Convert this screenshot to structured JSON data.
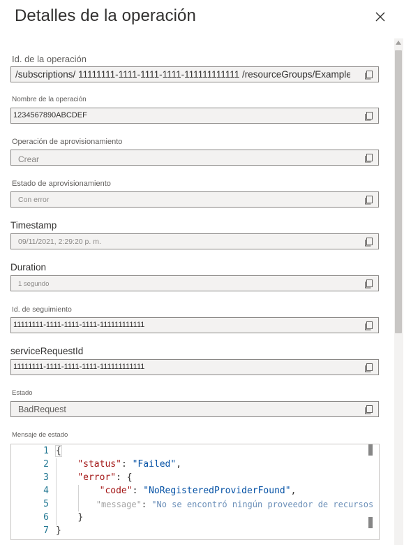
{
  "panel": {
    "title": "Detalles de la operación"
  },
  "fields": [
    {
      "label": "Id. de la operación",
      "value": "/subscriptions/ 11111111-1111-1111-1111-111111111111 /resourceGroups/Example..."
    },
    {
      "label": "Nombre de la operación",
      "value": "1234567890ABCDEF"
    },
    {
      "label": "Operación de aprovisionamiento",
      "value": "Crear"
    },
    {
      "label": "Estado de aprovisionamiento",
      "value": "Con error"
    },
    {
      "label": "Timestamp",
      "value": "09/11/2021, 2:29:20 p. m."
    },
    {
      "label": "Duration",
      "value": "1 segundo"
    },
    {
      "label": "Id. de seguimiento",
      "value": "11111111-1111-1111-1111-111111111111"
    },
    {
      "label": "serviceRequestId",
      "value": "11111111-1111-1111-1111-111111111111"
    },
    {
      "label": "Estado",
      "value": "BadRequest"
    }
  ],
  "status_message": {
    "label": "Mensaje de estado",
    "line_numbers": [
      "1",
      "2",
      "3",
      "4",
      "5",
      "6",
      "7"
    ],
    "lines": [
      {
        "indent": "",
        "key": "",
        "sep": "",
        "val": "",
        "tail": "{"
      },
      {
        "indent": "    ",
        "key": "\"status\"",
        "sep": ": ",
        "val": "\"Failed\"",
        "tail": ","
      },
      {
        "indent": "    ",
        "key": "\"error\"",
        "sep": ": ",
        "val": "",
        "tail": "{"
      },
      {
        "indent": "        ",
        "key": "\"code\"",
        "sep": ": ",
        "val": "\"NoRegisteredProviderFound\"",
        "tail": ","
      },
      {
        "indent": "        ",
        "key": "\"message\"",
        "sep": ": ",
        "val": "\"No se encontró ningún proveedor de recursos registrado",
        "tail": ""
      },
      {
        "indent": "    ",
        "key": "",
        "sep": "",
        "val": "",
        "tail": "}"
      },
      {
        "indent": "",
        "key": "",
        "sep": "",
        "val": "",
        "tail": "}"
      }
    ]
  },
  "icons": {
    "close": "close-icon",
    "copy": "copy-icon"
  }
}
